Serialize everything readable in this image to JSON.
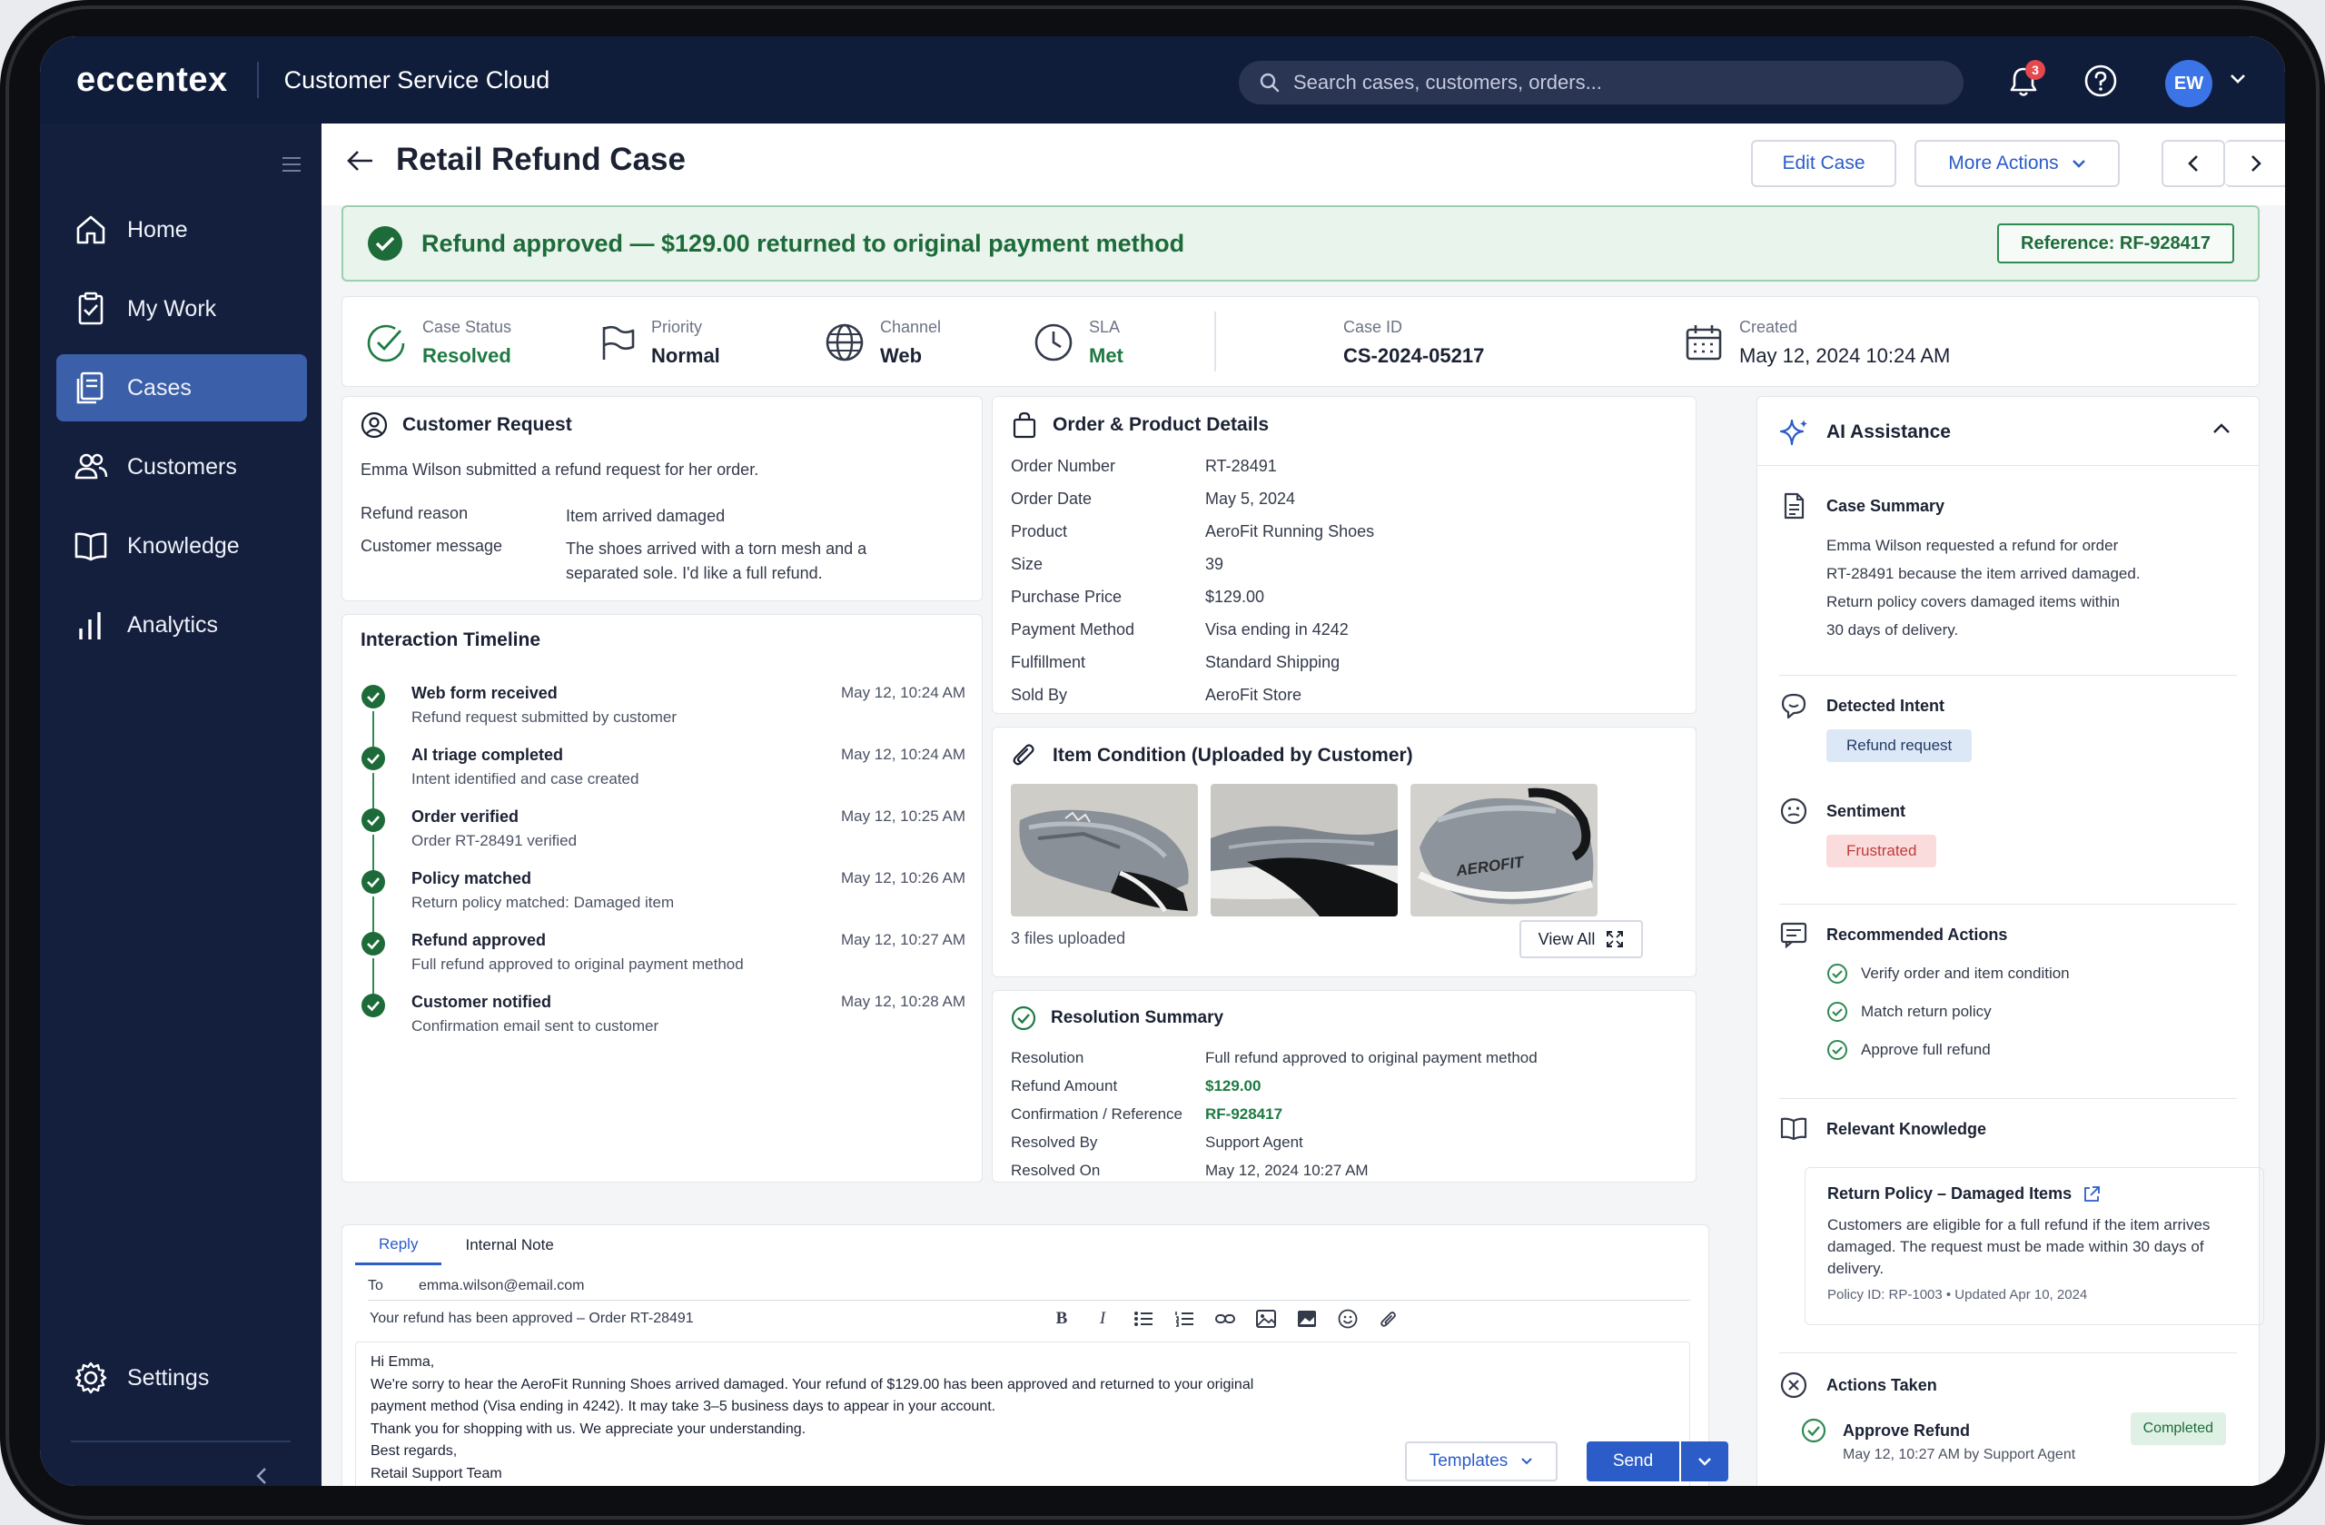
{
  "app": {
    "logo": "eccentex",
    "name": "Customer Service Cloud",
    "search_placeholder": "Search cases, customers, orders...",
    "notification_count": "3",
    "avatar_initials": "EW"
  },
  "sidebar": {
    "items": [
      {
        "label": "Home",
        "icon": "home-icon"
      },
      {
        "label": "My Work",
        "icon": "clipboard-icon"
      },
      {
        "label": "Cases",
        "icon": "cases-icon",
        "active": true
      },
      {
        "label": "Customers",
        "icon": "users-icon"
      },
      {
        "label": "Knowledge",
        "icon": "book-icon"
      },
      {
        "label": "Analytics",
        "icon": "bar-chart-icon"
      }
    ],
    "settings_label": "Settings"
  },
  "header": {
    "title": "Retail Refund Case",
    "edit_label": "Edit Case",
    "more_label": "More Actions"
  },
  "banner": {
    "text": "Refund approved — $129.00 returned to original payment method",
    "reference": "Reference: RF-928417"
  },
  "stats": {
    "status_label": "Case Status",
    "status_value": "Resolved",
    "priority_label": "Priority",
    "priority_value": "Normal",
    "channel_label": "Channel",
    "channel_value": "Web",
    "sla_label": "SLA",
    "sla_value": "Met",
    "caseid_label": "Case ID",
    "caseid_value": "CS-2024-05217",
    "created_label": "Created",
    "created_value": "May 12, 2024 10:24 AM"
  },
  "customer_request": {
    "title": "Customer Request",
    "intro": "Emma Wilson submitted a refund request for her order.",
    "reason_label": "Refund reason",
    "reason_value": "Item arrived damaged",
    "message_label": "Customer message",
    "message_value": "The shoes arrived with a torn mesh and a separated sole. I'd like a full refund."
  },
  "timeline": {
    "title": "Interaction Timeline",
    "items": [
      {
        "title": "Web form received",
        "desc": "Refund request submitted by customer",
        "time": "May 12, 10:24 AM"
      },
      {
        "title": "AI triage completed",
        "desc": "Intent identified and case created",
        "time": "May 12, 10:24 AM"
      },
      {
        "title": "Order verified",
        "desc": "Order RT-28491 verified",
        "time": "May 12, 10:25 AM"
      },
      {
        "title": "Policy matched",
        "desc": "Return policy matched: Damaged item",
        "time": "May 12, 10:26 AM"
      },
      {
        "title": "Refund approved",
        "desc": "Full refund approved to original payment method",
        "time": "May 12, 10:27 AM"
      },
      {
        "title": "Customer notified",
        "desc": "Confirmation email sent to customer",
        "time": "May 12, 10:28 AM"
      }
    ]
  },
  "order": {
    "title": "Order & Product Details",
    "rows": [
      {
        "k": "Order Number",
        "v": "RT-28491"
      },
      {
        "k": "Order Date",
        "v": "May 5, 2024"
      },
      {
        "k": "Product",
        "v": "AeroFit Running Shoes"
      },
      {
        "k": "Size",
        "v": "39"
      },
      {
        "k": "Purchase Price",
        "v": "$129.00"
      },
      {
        "k": "Payment Method",
        "v": "Visa ending in 4242"
      },
      {
        "k": "Fulfillment",
        "v": "Standard Shipping"
      },
      {
        "k": "Sold By",
        "v": "AeroFit Store"
      }
    ]
  },
  "item_condition": {
    "title": "Item Condition (Uploaded by Customer)",
    "files": "3 files uploaded",
    "view_all": "View All",
    "photo3_text": "AEROFIT"
  },
  "resolution": {
    "title": "Resolution Summary",
    "rows": [
      {
        "k": "Resolution",
        "v": "Full refund approved to original payment method"
      },
      {
        "k": "Refund Amount",
        "v": "$129.00"
      },
      {
        "k": "Confirmation / Reference",
        "v": "RF-928417"
      },
      {
        "k": "Resolved By",
        "v": "Support Agent"
      },
      {
        "k": "Resolved On",
        "v": "May 12, 2024 10:27 AM"
      }
    ]
  },
  "reply": {
    "tab_reply": "Reply",
    "tab_note": "Internal Note",
    "to_label": "To",
    "to_value": "emma.wilson@email.com",
    "subject": "Your refund has been approved – Order RT-28491",
    "body": [
      "Hi Emma,",
      "We're sorry to hear the AeroFit Running Shoes arrived damaged. Your refund of $129.00 has been approved and returned to your original",
      "payment method (Visa ending in 4242). It may take 3–5 business days to appear in your account.",
      "Thank you for shopping with us. We appreciate your understanding.",
      "Best regards,",
      "Retail Support Team"
    ],
    "templates_label": "Templates",
    "send_label": "Send"
  },
  "ai": {
    "title": "AI Assistance",
    "summary_title": "Case Summary",
    "summary_lines": [
      "Emma Wilson requested a refund for order",
      "RT-28491 because the item arrived damaged.",
      "Return policy covers damaged items within",
      "30 days of delivery."
    ],
    "intent_title": "Detected Intent",
    "intent_value": "Refund request",
    "sentiment_title": "Sentiment",
    "sentiment_value": "Frustrated",
    "recommended_title": "Recommended Actions",
    "recommended": [
      "Verify order and item condition",
      "Match return policy",
      "Approve full refund"
    ],
    "knowledge_title": "Relevant Knowledge",
    "kb_title": "Return Policy – Damaged Items",
    "kb_body": "Customers are eligible for a full refund if the item arrives damaged. The request must be made within 30 days of delivery.",
    "kb_meta": "Policy ID: RP-1003  •  Updated Apr 10, 2024",
    "actions_title": "Actions Taken",
    "action_name": "Approve Refund",
    "action_meta": "May 12, 10:27 AM by Support Agent",
    "action_status": "Completed"
  },
  "colors": {
    "primary": "#2b5cc8",
    "success": "#1e7a43",
    "nav_bg": "#131f3d",
    "danger": "#c23b3b"
  }
}
